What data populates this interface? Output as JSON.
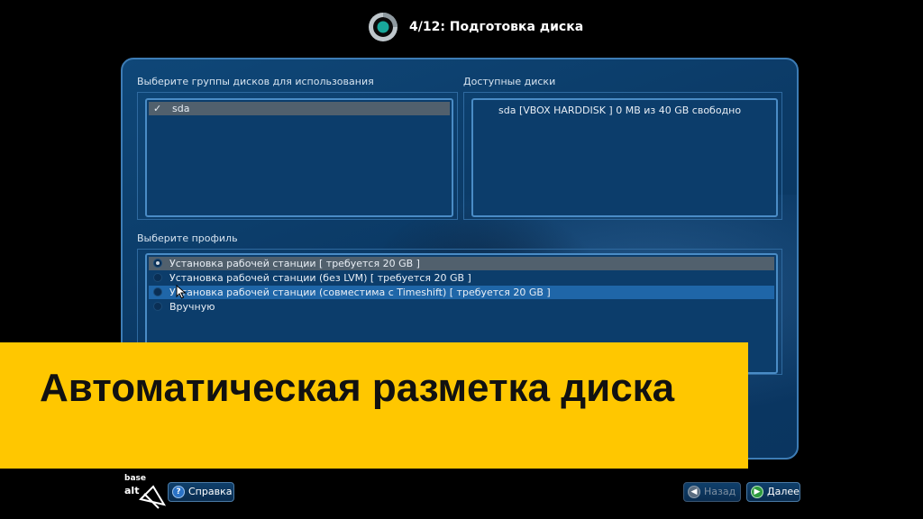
{
  "header": {
    "step_title": "4/12: Подготовка диска"
  },
  "disk_groups": {
    "label": "Выберите группы дисков для использования",
    "items": [
      {
        "check": "✓",
        "name": "sda",
        "checked": true
      }
    ]
  },
  "available_disks": {
    "label": "Доступные диски",
    "items": [
      {
        "text": "sda [VBOX HARDDISK   ]  0 MB из 40 GB свободно"
      }
    ]
  },
  "profile": {
    "label": "Выберите профиль",
    "options": [
      {
        "text": "Установка рабочей станции [ требуется 20 GB ]",
        "selected": true
      },
      {
        "text": "Установка рабочей станции (без LVM) [ требуется 20 GB ]",
        "selected": false
      },
      {
        "text": "Установка рабочей станции (совместима с Timeshift) [ требуется 20 GB ]",
        "selected": false,
        "hovered": true
      },
      {
        "text": "Вручную",
        "selected": false
      }
    ]
  },
  "banner": {
    "text": "Автоматическая разметка диска",
    "color": "#ffc700"
  },
  "footer": {
    "logo_top": "base",
    "logo_bottom": "alt",
    "help_label": "Справка",
    "back_label": "Назад",
    "next_label": "Далее"
  },
  "colors": {
    "accent": "#3d7cb5",
    "panel_bg": "#0b3a66",
    "highlight": "#1f66a8"
  }
}
